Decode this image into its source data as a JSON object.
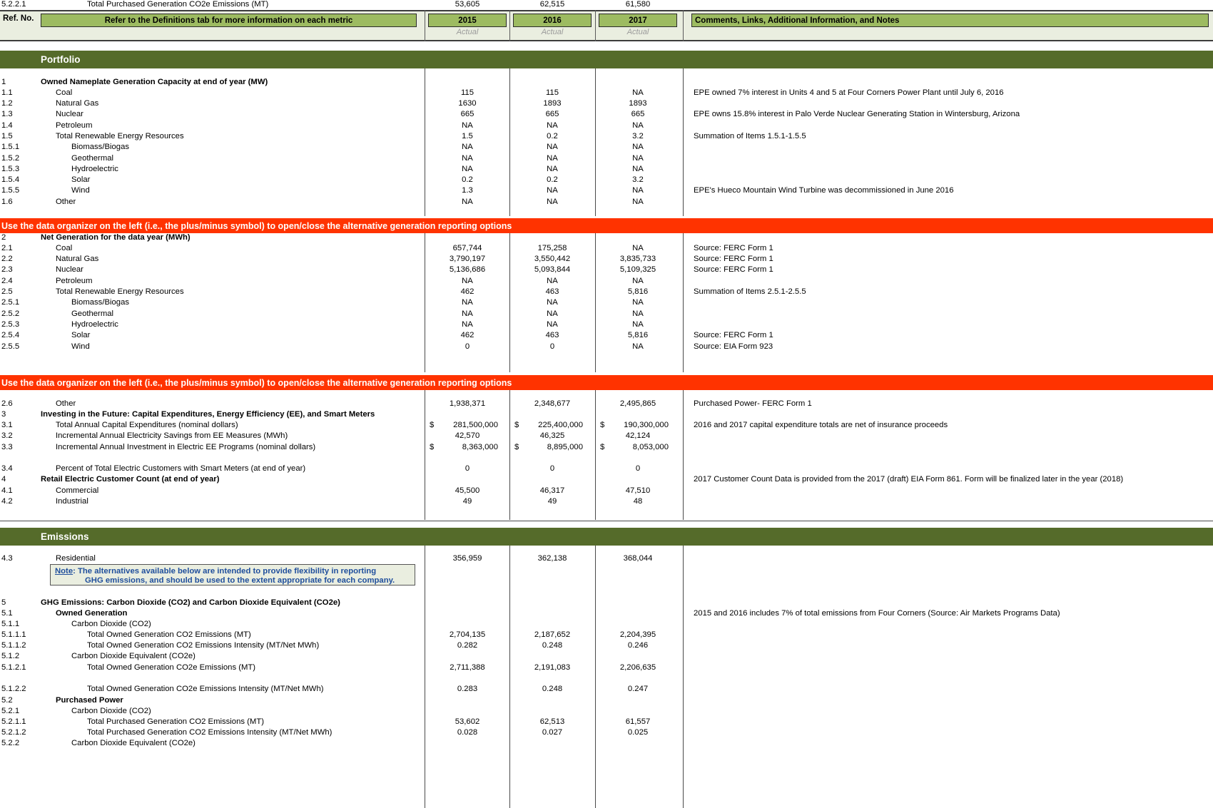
{
  "header": {
    "ref_no_label": "Ref. No.",
    "metric_banner": "Refer to the Definitions tab for more information on each metric",
    "notes_banner": "Comments, Links, Additional Information, and Notes",
    "years": [
      {
        "year": "2015",
        "basis": "Actual"
      },
      {
        "year": "2016",
        "basis": "Actual"
      },
      {
        "year": "2017",
        "basis": "Actual"
      }
    ]
  },
  "colors": {
    "section_bar": "#556b2a",
    "alert_bar": "#ff3300",
    "header_chip": "#9dbb61",
    "header_band": "#eaeee0",
    "note_text": "#1f4e9c"
  },
  "sections": [
    {
      "title": "Portfolio"
    },
    {
      "title": "Emissions"
    }
  ],
  "alerts": [
    "Use the data organizer on the left (i.e., the plus/minus symbol) to open/close the alternative generation reporting options",
    "Use the data organizer on the left (i.e., the plus/minus symbol) to open/close the alternative generation reporting options"
  ],
  "note_box": {
    "line1_prefix": "Note",
    "line1": ":  The alternatives available below are intended to provide flexibility in reporting",
    "line2": "GHG emissions, and should be used to the extent appropriate for each company."
  },
  "rows": [
    {
      "ref": "1",
      "label": "Owned Nameplate Generation Capacity at end of year (MW)",
      "level": "0",
      "v2015": "",
      "v2016": "",
      "v2017": "",
      "note": ""
    },
    {
      "ref": "1.1",
      "label": "Coal",
      "level": "1",
      "v2015": "115",
      "v2016": "115",
      "v2017": "NA",
      "note": "EPE owned 7% interest in Units 4 and 5 at Four Corners Power Plant until  July 6, 2016"
    },
    {
      "ref": "1.2",
      "label": "Natural Gas",
      "level": "1",
      "v2015": "1630",
      "v2016": "1893",
      "v2017": "1893",
      "note": ""
    },
    {
      "ref": "1.3",
      "label": "Nuclear",
      "level": "1",
      "v2015": "665",
      "v2016": "665",
      "v2017": "665",
      "note": "EPE owns 15.8% interest in Palo Verde Nuclear Generating Station in Wintersburg, Arizona"
    },
    {
      "ref": "1.4",
      "label": "Petroleum",
      "level": "1",
      "v2015": "NA",
      "v2016": "NA",
      "v2017": "NA",
      "note": ""
    },
    {
      "ref": "1.5",
      "label": "Total Renewable Energy Resources",
      "level": "1",
      "v2015": "1.5",
      "v2016": "0.2",
      "v2017": "3.2",
      "note": "Summation of Items 1.5.1-1.5.5"
    },
    {
      "ref": "1.5.1",
      "label": "Biomass/Biogas",
      "level": "2",
      "v2015": "NA",
      "v2016": "NA",
      "v2017": "NA",
      "note": ""
    },
    {
      "ref": "1.5.2",
      "label": "Geothermal",
      "level": "2",
      "v2015": "NA",
      "v2016": "NA",
      "v2017": "NA",
      "note": ""
    },
    {
      "ref": "1.5.3",
      "label": "Hydroelectric",
      "level": "2",
      "v2015": "NA",
      "v2016": "NA",
      "v2017": "NA",
      "note": ""
    },
    {
      "ref": "1.5.4",
      "label": "Solar",
      "level": "2",
      "v2015": "0.2",
      "v2016": "0.2",
      "v2017": "3.2",
      "note": ""
    },
    {
      "ref": "1.5.5",
      "label": "Wind",
      "level": "2",
      "v2015": "1.3",
      "v2016": "NA",
      "v2017": "NA",
      "note": "EPE's Hueco Mountain Wind Turbine was decommissioned in June 2016"
    },
    {
      "ref": "1.6",
      "label": "Other",
      "level": "1",
      "v2015": "NA",
      "v2016": "NA",
      "v2017": "NA",
      "note": ""
    },
    {
      "ref": "2",
      "label": "Net Generation for the data year (MWh)",
      "level": "0",
      "v2015": "",
      "v2016": "",
      "v2017": "",
      "note": ""
    },
    {
      "ref": "2.1",
      "label": "Coal",
      "level": "1",
      "v2015": "657,744",
      "v2016": "175,258",
      "v2017": "NA",
      "note": "Source: FERC Form 1"
    },
    {
      "ref": "2.2",
      "label": "Natural Gas",
      "level": "1",
      "v2015": "3,790,197",
      "v2016": "3,550,442",
      "v2017": "3,835,733",
      "note": "Source: FERC Form 1"
    },
    {
      "ref": "2.3",
      "label": "Nuclear",
      "level": "1",
      "v2015": "5,136,686",
      "v2016": "5,093,844",
      "v2017": "5,109,325",
      "note": "Source: FERC Form 1"
    },
    {
      "ref": "2.4",
      "label": "Petroleum",
      "level": "1",
      "v2015": "NA",
      "v2016": "NA",
      "v2017": "NA",
      "note": ""
    },
    {
      "ref": "2.5",
      "label": "Total Renewable Energy Resources",
      "level": "1",
      "v2015": "462",
      "v2016": "463",
      "v2017": "5,816",
      "note": "Summation of Items 2.5.1-2.5.5"
    },
    {
      "ref": "2.5.1",
      "label": "Biomass/Biogas",
      "level": "2",
      "v2015": "NA",
      "v2016": "NA",
      "v2017": "NA",
      "note": ""
    },
    {
      "ref": "2.5.2",
      "label": "Geothermal",
      "level": "2",
      "v2015": "NA",
      "v2016": "NA",
      "v2017": "NA",
      "note": ""
    },
    {
      "ref": "2.5.3",
      "label": "Hydroelectric",
      "level": "2",
      "v2015": "NA",
      "v2016": "NA",
      "v2017": "NA",
      "note": ""
    },
    {
      "ref": "2.5.4",
      "label": "Solar",
      "level": "2",
      "v2015": "462",
      "v2016": "463",
      "v2017": "5,816",
      "note": "Source: FERC Form 1"
    },
    {
      "ref": "2.5.5",
      "label": "Wind",
      "level": "2",
      "v2015": "0",
      "v2016": "0",
      "v2017": "NA",
      "note": "Source: EIA Form 923"
    },
    {
      "ref": "2.6",
      "label": "Other",
      "level": "1",
      "v2015": "1,938,371",
      "v2016": "2,348,677",
      "v2017": "2,495,865",
      "note": "Purchased Power- FERC Form 1"
    },
    {
      "ref": "3",
      "label": "Investing in the Future:  Capital Expenditures, Energy Efficiency (EE), and Smart Meters",
      "level": "0",
      "v2015": "",
      "v2016": "",
      "v2017": "",
      "note": ""
    },
    {
      "ref": "3.1",
      "label": "Total Annual Capital Expenditures (nominal dollars)",
      "level": "1",
      "v2015": "281,500,000",
      "v2016": "225,400,000",
      "v2017": "190,300,000",
      "currency": true,
      "note": "2016 and 2017 capital expenditure totals are net of insurance proceeds"
    },
    {
      "ref": "3.2",
      "label": "Incremental Annual Electricity Savings from EE Measures (MWh)",
      "level": "1",
      "v2015": "42,570",
      "v2016": "46,325",
      "v2017": "42,124",
      "note": ""
    },
    {
      "ref": "3.3",
      "label": "Incremental Annual Investment in Electric EE Programs (nominal dollars)",
      "level": "1",
      "v2015": "8,363,000",
      "v2016": "8,895,000",
      "v2017": "8,053,000",
      "currency": true,
      "note": ""
    },
    {
      "ref": "3.4",
      "label": "Percent of Total Electric Customers with Smart Meters (at end of year)",
      "level": "1",
      "v2015": "0",
      "v2016": "0",
      "v2017": "0",
      "note": ""
    },
    {
      "ref": "4",
      "label": "Retail Electric Customer Count (at end of year)",
      "level": "0",
      "v2015": "",
      "v2016": "",
      "v2017": "",
      "note": "2017 Customer Count Data is provided from the 2017 (draft) EIA Form 861. Form will be finalized later in the year (2018)"
    },
    {
      "ref": "4.1",
      "label": "Commercial",
      "level": "1",
      "v2015": "45,500",
      "v2016": "46,317",
      "v2017": "47,510",
      "note": ""
    },
    {
      "ref": "4.2",
      "label": "Industrial",
      "level": "1",
      "v2015": "49",
      "v2016": "49",
      "v2017": "48",
      "note": ""
    },
    {
      "ref": "4.3",
      "label": "Residential",
      "level": "1",
      "v2015": "356,959",
      "v2016": "362,138",
      "v2017": "368,044",
      "note": ""
    },
    {
      "ref": "5",
      "label": "GHG Emissions: Carbon Dioxide (CO2) and Carbon Dioxide Equivalent (CO2e)",
      "level": "0",
      "v2015": "",
      "v2016": "",
      "v2017": "",
      "note": ""
    },
    {
      "ref": "5.1",
      "label": "Owned Generation",
      "level": "1b",
      "v2015": "",
      "v2016": "",
      "v2017": "",
      "note": "2015 and 2016 includes 7% of total emissions from Four Corners (Source: Air Markets Programs Data)"
    },
    {
      "ref": "5.1.1",
      "label": "Carbon Dioxide (CO2)",
      "level": "2",
      "v2015": "",
      "v2016": "",
      "v2017": "",
      "note": ""
    },
    {
      "ref": "5.1.1.1",
      "label": "Total Owned Generation CO2 Emissions (MT)",
      "level": "3",
      "v2015": "2,704,135",
      "v2016": "2,187,652",
      "v2017": "2,204,395",
      "note": ""
    },
    {
      "ref": "5.1.1.2",
      "label": "Total Owned Generation CO2 Emissions Intensity (MT/Net MWh)",
      "level": "3",
      "v2015": "0.282",
      "v2016": "0.248",
      "v2017": "0.246",
      "note": ""
    },
    {
      "ref": "5.1.2",
      "label": "Carbon Dioxide Equivalent (CO2e)",
      "level": "2",
      "v2015": "",
      "v2016": "",
      "v2017": "",
      "note": ""
    },
    {
      "ref": "5.1.2.1",
      "label": "Total Owned Generation CO2e Emissions (MT)",
      "level": "3",
      "v2015": "2,711,388",
      "v2016": "2,191,083",
      "v2017": "2,206,635",
      "note": ""
    },
    {
      "ref": "5.1.2.2",
      "label": "Total Owned Generation CO2e Emissions Intensity (MT/Net MWh)",
      "level": "3",
      "v2015": "0.283",
      "v2016": "0.248",
      "v2017": "0.247",
      "note": ""
    },
    {
      "ref": "5.2",
      "label": "Purchased Power",
      "level": "1b",
      "v2015": "",
      "v2016": "",
      "v2017": "",
      "note": ""
    },
    {
      "ref": "5.2.1",
      "label": "Carbon Dioxide (CO2)",
      "level": "2",
      "v2015": "",
      "v2016": "",
      "v2017": "",
      "note": ""
    },
    {
      "ref": "5.2.1.1",
      "label": "Total Purchased Generation CO2 Emissions (MT)",
      "level": "3",
      "v2015": "53,602",
      "v2016": "62,513",
      "v2017": "61,557",
      "note": ""
    },
    {
      "ref": "5.2.1.2",
      "label": "Total Purchased Generation CO2 Emissions Intensity (MT/Net MWh)",
      "level": "3",
      "v2015": "0.028",
      "v2016": "0.027",
      "v2017": "0.025",
      "note": ""
    },
    {
      "ref": "5.2.2",
      "label": "Carbon Dioxide Equivalent (CO2e)",
      "level": "2",
      "v2015": "",
      "v2016": "",
      "v2017": "",
      "note": ""
    },
    {
      "ref": "5.2.2.1",
      "label": "Total Purchased Generation CO2e Emissions (MT)",
      "level": "3",
      "v2015": "53,605",
      "v2016": "62,515",
      "v2017": "61,580",
      "note": ""
    }
  ]
}
